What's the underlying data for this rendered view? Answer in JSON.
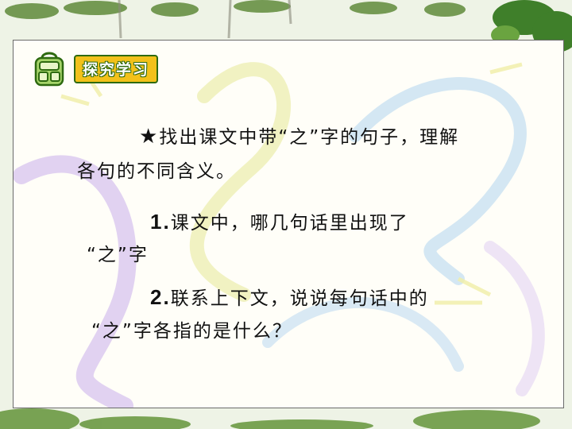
{
  "section_title": "探究学习",
  "task": {
    "star": "★",
    "line1": "找出课文中带“之”字的句子，理解",
    "line2": "各句的不同含义。"
  },
  "item1": {
    "number": "1.",
    "line1": "课文中，哪几句话里出现了",
    "line2": "“之”字"
  },
  "item2": {
    "number": "2.",
    "line1": "联系上下文，说说每句话中的",
    "line2": "“之”字各指的是什么？"
  }
}
